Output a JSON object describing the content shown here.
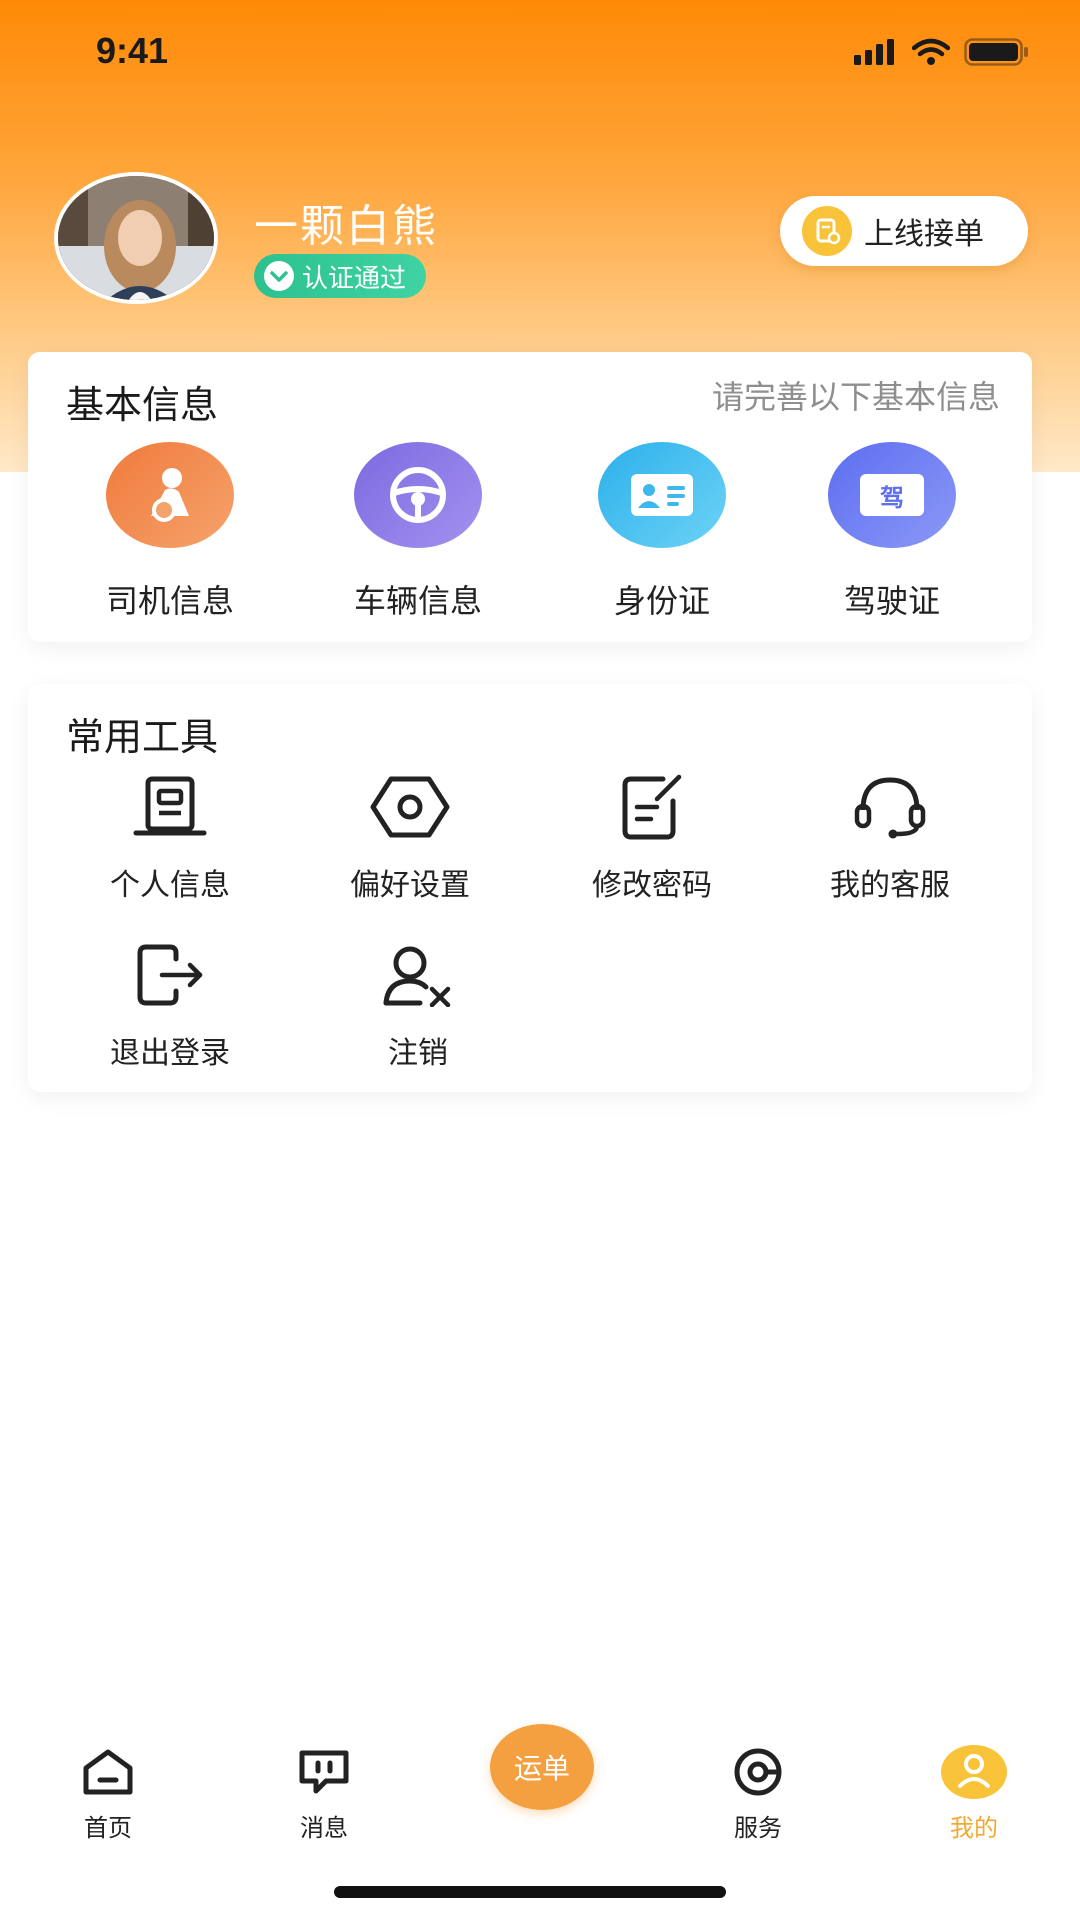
{
  "status_bar": {
    "time": "9:41"
  },
  "profile": {
    "name": "一颗白熊",
    "verify_label": "认证通过",
    "online_button": "上线接单"
  },
  "basic_info": {
    "title": "基本信息",
    "hint": "请完善以下基本信息",
    "items": [
      {
        "label": "司机信息",
        "icon": "driver-icon",
        "color": "#f2844a"
      },
      {
        "label": "车辆信息",
        "icon": "steering-wheel-icon",
        "color": "#8a76e6"
      },
      {
        "label": "身份证",
        "icon": "id-card-icon",
        "color": "#3eb8ec"
      },
      {
        "label": "驾驶证",
        "icon": "license-icon",
        "color": "#6a78f0"
      }
    ],
    "license_glyph": "驾"
  },
  "tools": {
    "title": "常用工具",
    "items": [
      {
        "label": "个人信息",
        "icon": "profile-doc-icon"
      },
      {
        "label": "偏好设置",
        "icon": "settings-hex-icon"
      },
      {
        "label": "修改密码",
        "icon": "edit-doc-icon"
      },
      {
        "label": "我的客服",
        "icon": "headset-icon"
      },
      {
        "label": "退出登录",
        "icon": "logout-icon"
      },
      {
        "label": "注销",
        "icon": "user-remove-icon"
      }
    ]
  },
  "tab_bar": {
    "items": [
      {
        "label": "首页",
        "icon": "home-icon"
      },
      {
        "label": "消息",
        "icon": "message-icon"
      },
      {
        "label": "运单",
        "icon": "waybill-button"
      },
      {
        "label": "服务",
        "icon": "service-icon"
      },
      {
        "label": "我的",
        "icon": "user-icon"
      }
    ],
    "active_index": 4,
    "accent": "#f4a834"
  },
  "colors": {
    "header_top": "#ff8a06",
    "verify_green": "#2cc18e",
    "accent": "#f4a040"
  }
}
